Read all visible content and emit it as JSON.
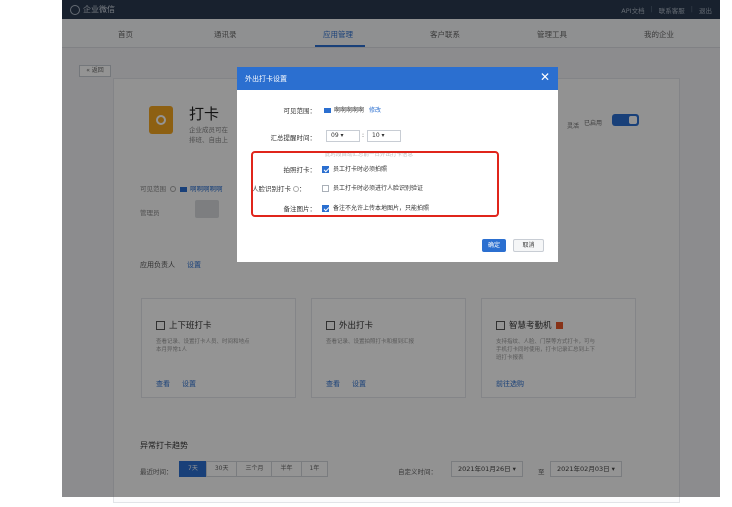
{
  "topbar": {
    "logo_text": "企业微信",
    "links": [
      "API文档",
      "联系客服",
      "退出"
    ]
  },
  "nav": {
    "items": [
      "首页",
      "通讯录",
      "应用管理",
      "客户联系",
      "管理工具",
      "我的企业"
    ],
    "active_index": 2
  },
  "back_label": "« 返回",
  "app": {
    "title": "打卡",
    "desc1": "企业成员可在",
    "desc2": "排班、自由上",
    "enabled_pre": "灵活",
    "enabled_label": "已启用",
    "scope_label": "可见范围",
    "scope_value": "啊啊啊啊啊",
    "admin_label": "管理员",
    "owner_label": "应用负责人",
    "owner_set": "设置"
  },
  "subcards": [
    {
      "title": "上下班打卡",
      "desc": [
        "查看记录、设置打卡人员、时间和地点",
        "本月异常1人",
        ""
      ],
      "actions": [
        "查看",
        "设置"
      ]
    },
    {
      "title": "外出打卡",
      "desc": [
        "查看记录、设置拍照打卡和报到汇报",
        "",
        ""
      ],
      "actions": [
        "查看",
        "设置"
      ]
    },
    {
      "title": "智慧考勤机",
      "desc": [
        "支持指纹、人脸、门禁等方式打卡，可与",
        "手机打卡同时使用，打卡记录汇总到上下",
        "班打卡报表"
      ],
      "actions": [
        "前往选购",
        ""
      ]
    }
  ],
  "trend": {
    "title": "异常打卡趋势",
    "range_label": "最近时间：",
    "ranges": [
      "7天",
      "30天",
      "三个月",
      "半年",
      "1年"
    ],
    "selected_range": 0,
    "custom_label": "自定义时间：",
    "date_from": "2021年01月26日 ▾",
    "to_label": "至",
    "date_to": "2021年02月03日 ▾"
  },
  "modal": {
    "title": "外出打卡设置",
    "close": "✕",
    "scope_label": "可见范围：",
    "scope_value": "啊啊啊啊啊",
    "edit_link": "修改",
    "remind_label": "汇总提醒时间：",
    "hour": "09 ▾",
    "minute": "10 ▾",
    "colon": ":",
    "hint": "此时段自动汇总前一日外出打卡信息",
    "photo_label": "拍照打卡：",
    "photo_option": "员工打卡时必须拍照",
    "photo_checked": true,
    "face_label": "人脸识别打卡",
    "face_suffix": "：",
    "face_option": "员工打卡时必须进行人脸识别验证",
    "face_checked": false,
    "note_label": "备注图片：",
    "note_option": "备注不允许上传本地图片，只能拍照",
    "note_checked": true,
    "ok": "确定",
    "cancel": "取消"
  },
  "colors": {
    "accent": "#2b6fd0",
    "highlight": "#e0251b",
    "app_icon": "#f3a51f"
  }
}
